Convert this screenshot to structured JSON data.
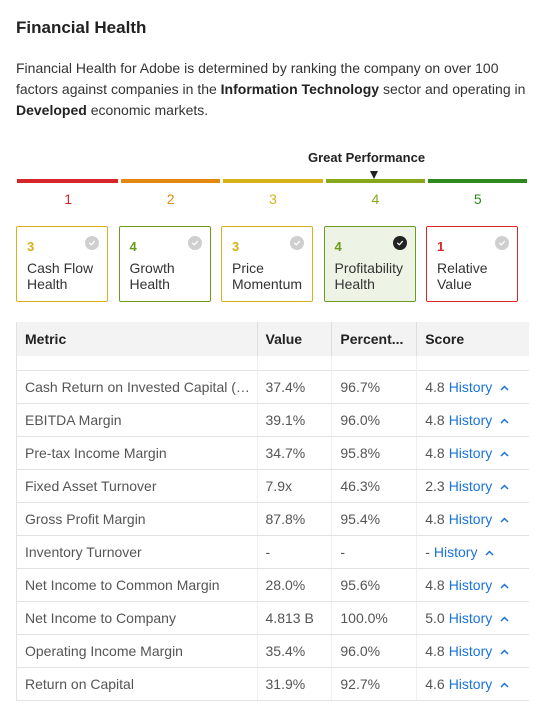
{
  "header": {
    "title": "Financial Health",
    "description": {
      "part1": "Financial Health for Adobe is determined by ranking the company on over 100 factors against companies in the ",
      "sector": "Information Technology",
      "part2": " sector and operating in ",
      "market": "Developed",
      "part3": " economic markets."
    }
  },
  "scale": {
    "current_label": "Great Performance",
    "current_value": 4,
    "segments": [
      {
        "label": "1",
        "color": "#d7262a"
      },
      {
        "label": "2",
        "color": "#e3890f"
      },
      {
        "label": "3",
        "color": "#d9b11a"
      },
      {
        "label": "4",
        "color": "#86a81a"
      },
      {
        "label": "5",
        "color": "#2e8a1f"
      }
    ]
  },
  "cards": [
    {
      "score": "3",
      "label_line1": "Cash Flow",
      "label_line2": "Health",
      "color": "#d9b11a",
      "selected": false
    },
    {
      "score": "4",
      "label_line1": "Growth",
      "label_line2": "Health",
      "color": "#6c9a1c",
      "selected": false
    },
    {
      "score": "3",
      "label_line1": "Price",
      "label_line2": "Momentum",
      "color": "#d9b11a",
      "selected": false
    },
    {
      "score": "4",
      "label_line1": "Profitability",
      "label_line2": "Health",
      "color": "#6c9a1c",
      "selected": true
    },
    {
      "score": "1",
      "label_line1": "Relative",
      "label_line2": "Value",
      "color": "#d7262a",
      "selected": false
    }
  ],
  "table": {
    "columns": [
      "Metric",
      "Value",
      "Percent...",
      "Score"
    ],
    "history_label": "History",
    "rows": [
      {
        "metric": "Cash Return on Invested Capital (CROIC)",
        "value": "37.4%",
        "percentile": "96.7%",
        "score": "4.8"
      },
      {
        "metric": "EBITDA Margin",
        "value": "39.1%",
        "percentile": "96.0%",
        "score": "4.8"
      },
      {
        "metric": "Pre-tax Income Margin",
        "value": "34.7%",
        "percentile": "95.8%",
        "score": "4.8"
      },
      {
        "metric": "Fixed Asset Turnover",
        "value": "7.9x",
        "percentile": "46.3%",
        "score": "2.3"
      },
      {
        "metric": "Gross Profit Margin",
        "value": "87.8%",
        "percentile": "95.4%",
        "score": "4.8"
      },
      {
        "metric": "Inventory Turnover",
        "value": "-",
        "percentile": "-",
        "score": "-"
      },
      {
        "metric": "Net Income to Common Margin",
        "value": "28.0%",
        "percentile": "95.6%",
        "score": "4.8"
      },
      {
        "metric": "Net Income to Company",
        "value": "4.813 B",
        "percentile": "100.0%",
        "score": "5.0"
      },
      {
        "metric": "Operating Income Margin",
        "value": "35.4%",
        "percentile": "96.0%",
        "score": "4.8"
      },
      {
        "metric": "Return on Capital",
        "value": "31.9%",
        "percentile": "92.7%",
        "score": "4.6"
      }
    ]
  }
}
